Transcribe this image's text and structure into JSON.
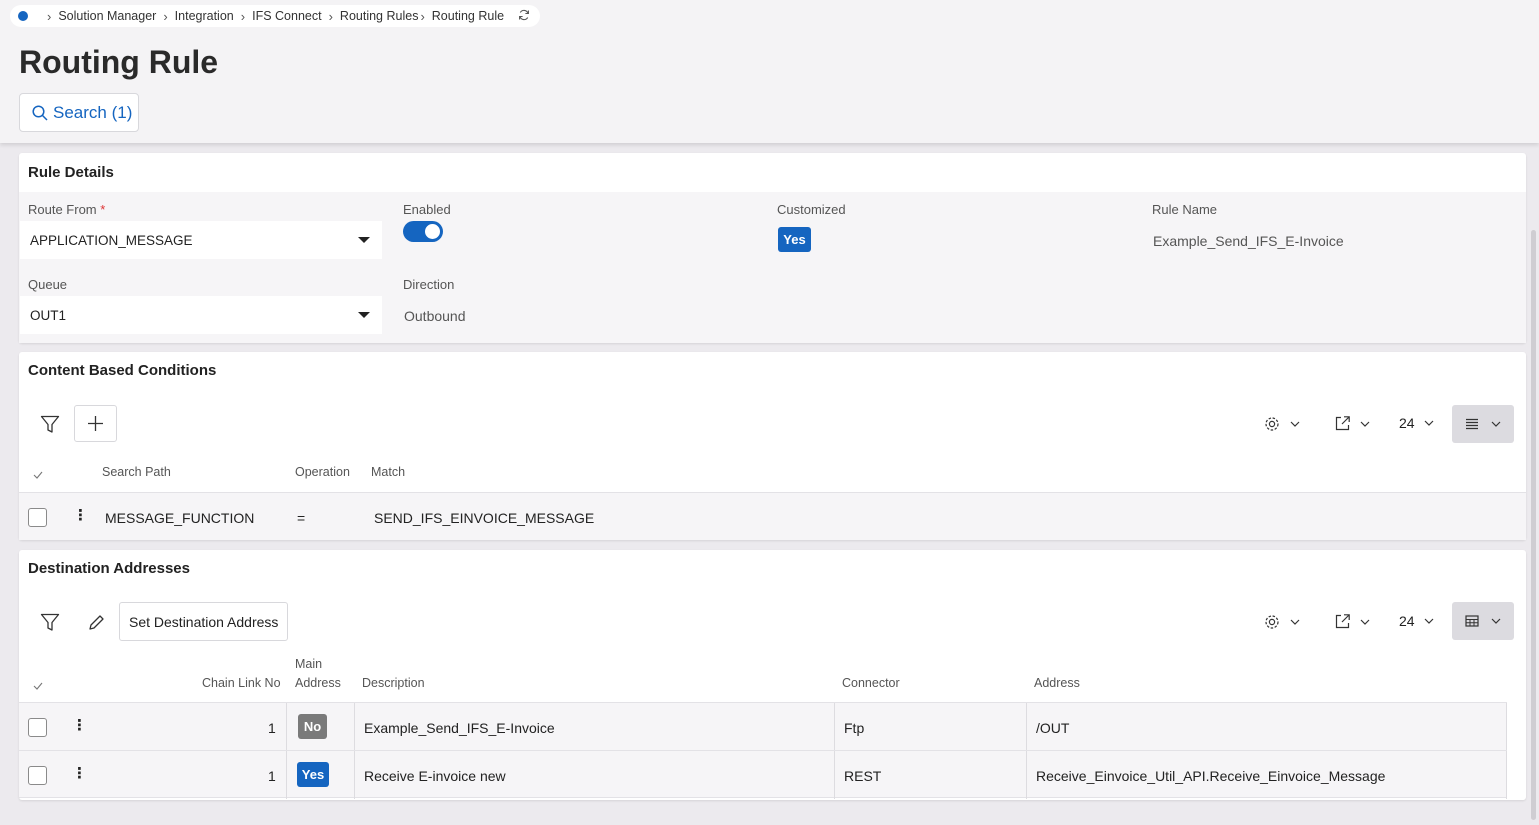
{
  "breadcrumb": {
    "items": [
      "Solution Manager",
      "Integration",
      "IFS Connect",
      "Routing Rules",
      "Routing Rule"
    ]
  },
  "page": {
    "title": "Routing Rule",
    "search_label": "Search (1)"
  },
  "rule_details": {
    "title": "Rule Details",
    "route_from_label": "Route From",
    "route_from_required": "*",
    "route_from_value": "APPLICATION_MESSAGE",
    "enabled_label": "Enabled",
    "enabled": true,
    "customized_label": "Customized",
    "customized_value": "Yes",
    "rule_name_label": "Rule Name",
    "rule_name_value": "Example_Send_IFS_E-Invoice",
    "queue_label": "Queue",
    "queue_value": "OUT1",
    "direction_label": "Direction",
    "direction_value": "Outbound"
  },
  "content_conditions": {
    "title": "Content Based Conditions",
    "page_size": "24",
    "columns": [
      "Search Path",
      "Operation",
      "Match"
    ],
    "rows": [
      {
        "search_path": "MESSAGE_FUNCTION",
        "operation": "=",
        "match": "SEND_IFS_EINVOICE_MESSAGE"
      }
    ]
  },
  "destinations": {
    "title": "Destination Addresses",
    "set_button": "Set Destination Address",
    "page_size": "24",
    "columns": {
      "chain": "Chain Link No",
      "main_line1": "Main",
      "main_line2": "Address",
      "description": "Description",
      "connector": "Connector",
      "address": "Address"
    },
    "rows": [
      {
        "chain": "1",
        "main": "No",
        "description": "Example_Send_IFS_E-Invoice",
        "connector": "Ftp",
        "address": "/OUT"
      },
      {
        "chain": "1",
        "main": "Yes",
        "description": "Receive E-invoice new",
        "connector": "REST",
        "address": "Receive_Einvoice_Util_API.Receive_Einvoice_Message"
      }
    ]
  },
  "colors": {
    "accent": "#1565c0",
    "badge_no": "#7a7a7a",
    "required": "#dd3333"
  },
  "icons": [
    "home-dot-icon",
    "chevron-right-icon",
    "refresh-icon",
    "search-icon",
    "filter-icon",
    "plus-icon",
    "pencil-icon",
    "gear-icon",
    "export-icon",
    "chevron-down-icon",
    "list-view-icon",
    "table-view-icon",
    "check-icon",
    "kebab-icon"
  ]
}
